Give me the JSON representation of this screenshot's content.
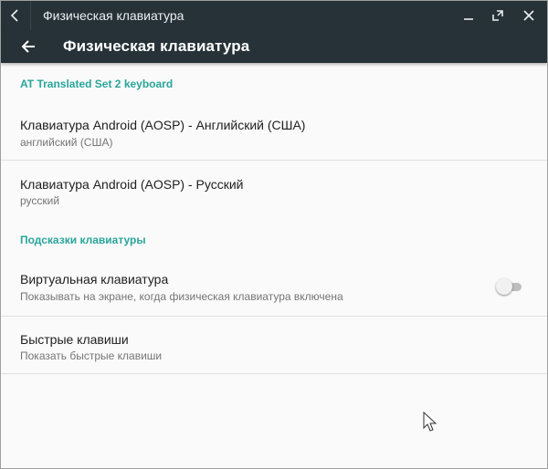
{
  "window": {
    "title": "Физическая клавиатура",
    "icons": {
      "back": "chevron-left-icon",
      "minimize": "minimize-icon",
      "maximize": "maximize-icon",
      "close": "close-icon"
    }
  },
  "appbar": {
    "title": "Физическая клавиатура",
    "back_icon": "arrow-back-icon"
  },
  "sections": [
    {
      "header": "AT Translated Set 2 keyboard",
      "items": [
        {
          "title": "Клавиатура Android (AOSP) - Английский (США)",
          "summary": "английский (США)"
        },
        {
          "title": "Клавиатура Android (AOSP) - Русский",
          "summary": "русский"
        }
      ]
    },
    {
      "header": "Подсказки клавиатуры",
      "items": [
        {
          "title": "Виртуальная клавиатура",
          "summary": "Показывать на экране, когда физическая клавиатура включена",
          "toggle": false
        },
        {
          "title": "Быстрые клавиши",
          "summary": "Показать быстрые клавиши"
        }
      ]
    }
  ],
  "colors": {
    "bar": "#263238",
    "accent": "#2aa59a",
    "background": "#fafafa"
  }
}
